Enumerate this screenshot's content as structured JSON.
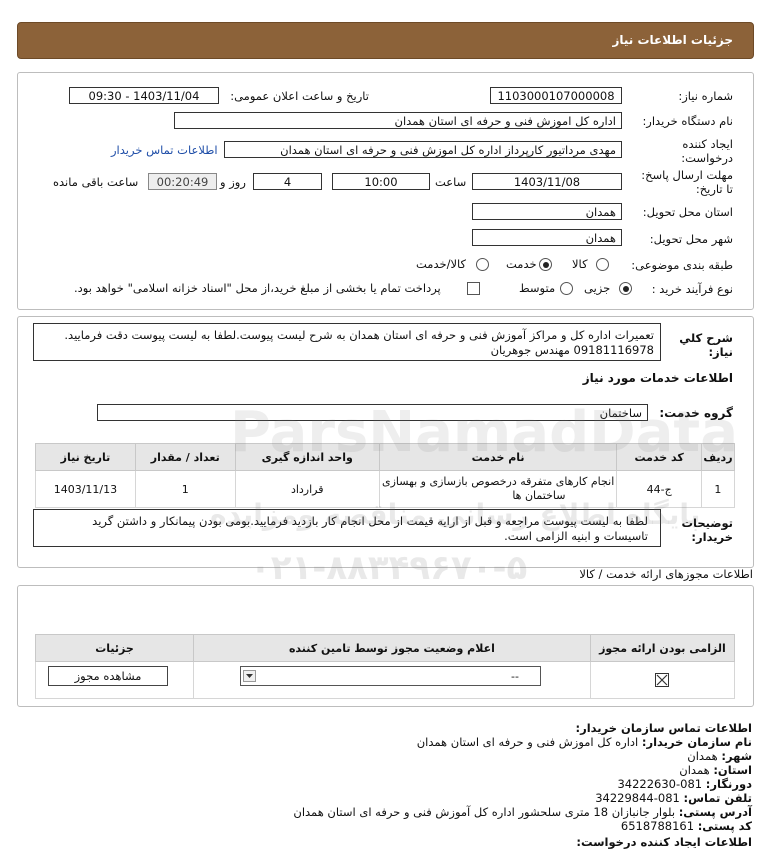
{
  "header": {
    "title": "جزئیات اطلاعات نیاز"
  },
  "form": {
    "need_number_label": "شماره نیاز:",
    "need_number": "1103000107000008",
    "announce_label": "تاریخ و ساعت اعلان عمومی:",
    "announce_value": "1403/11/04 - 09:30",
    "buyer_label": "نام دستگاه خریدار:",
    "buyer_value": "اداره کل اموزش فنی و حرفه ای استان همدان",
    "creator_label_1": "ایجاد کننده",
    "creator_label_2": "درخواست:",
    "creator_value": "مهدی مرداتیور کارپرداز اداره کل اموزش فنی و حرفه ای استان همدان",
    "contact_link": "اطلاعات تماس خریدار",
    "deadline_label_1": "مهلت ارسال پاسخ:",
    "deadline_label_2": "تا تاریخ:",
    "deadline_date": "1403/11/08",
    "time_label": "ساعت",
    "deadline_time": "10:00",
    "days_value": "4",
    "days_label": "روز و",
    "remaining_time": "00:20:49",
    "remaining_label": "ساعت باقی مانده",
    "province_label": "استان محل تحویل:",
    "province_value": "همدان",
    "city_label": "شهر محل تحویل:",
    "city_value": "همدان",
    "category_label": "طبقه بندی موضوعی:",
    "category_options": [
      "کالا",
      "خدمت",
      "کالا/خدمت"
    ],
    "category_selected": "خدمت",
    "process_label": "نوع فرآیند خرید :",
    "process_options": [
      "جزیی",
      "متوسط"
    ],
    "process_selected": "جزیی",
    "payment_note": "پرداخت تمام یا بخشی از مبلغ خرید،از محل \"اسناد خزانه اسلامی\" خواهد بود."
  },
  "description": {
    "label_1": "شرح کلي",
    "label_2": "نیاز:",
    "text_1": "تعمیرات اداره کل و مراکز آموزش فنی و حرفه ای استان همدان به شرح لیست پیوست.لطفا به لیست پیوست دقت فرمایید.",
    "text_2": "09181116978 مهندس جوهریان"
  },
  "services": {
    "title": "اطلاعات خدمات مورد نیاز",
    "group_label": "گروه خدمت:",
    "group_value": "ساختمان",
    "columns": [
      "ردیف",
      "کد خدمت",
      "نام خدمت",
      "واحد اندازه گیری",
      "تعداد / مقدار",
      "تاریخ نیاز"
    ],
    "rows": [
      {
        "row": "1",
        "code": "ج-44",
        "name_1": "انجام کارهای متفرقه درخصوص بازسازی و بهسازی",
        "name_2": "ساختمان ها",
        "unit": "قرارداد",
        "qty": "1",
        "date": "1403/11/13"
      }
    ]
  },
  "buyer_notes": {
    "label_1": "توضیحات",
    "label_2": "خریدار:",
    "text_1": "لطفا به لیست پیوست مراجعه و قبل از ارایه قیمت از محل انجام کار بازدید فرمایید.بومی بودن پیمانکار و داشتن گرید",
    "text_2": "تاسیسات و ابنیه الزامی است."
  },
  "licenses": {
    "title": "اطلاعات مجوزهای ارائه خدمت / کالا",
    "columns": [
      "الزامی بودن ارائه مجوز",
      "اعلام وضعیت مجوز توسط تامین کننده",
      "جزئیات"
    ],
    "select_value": "--",
    "view_button": "مشاهده مجوز"
  },
  "contact": {
    "title": "اطلاعات تماس سازمان خریدار:",
    "org_label": "نام سازمان خریدار:",
    "org_value": "اداره کل اموزش فنی و حرفه ای استان همدان",
    "city_label": "شهر:",
    "city_value": "همدان",
    "province_label": "استان:",
    "province_value": "همدان",
    "fax_label": "دورنگار:",
    "fax_value": "081-34222630",
    "phone_label": "تلفن تماس:",
    "phone_value": "081-34229844",
    "address_label": "آدرس پستی:",
    "address_value": "بلوار جانبازان 18 متری سلحشور اداره کل آموزش فنی و حرفه ای استان همدان",
    "postal_label": "کد پستی:",
    "postal_value": "6518788161",
    "creator_title": "اطلاعات ایجاد کننده درخواست:"
  },
  "watermark": {
    "brand": "ParsNamadData",
    "tagline": "پایگاه اطلاع رسانی مناقصه ومزایده",
    "phone": "۰۲۱-۸۸۳۴۹۶۷۰-۵"
  }
}
